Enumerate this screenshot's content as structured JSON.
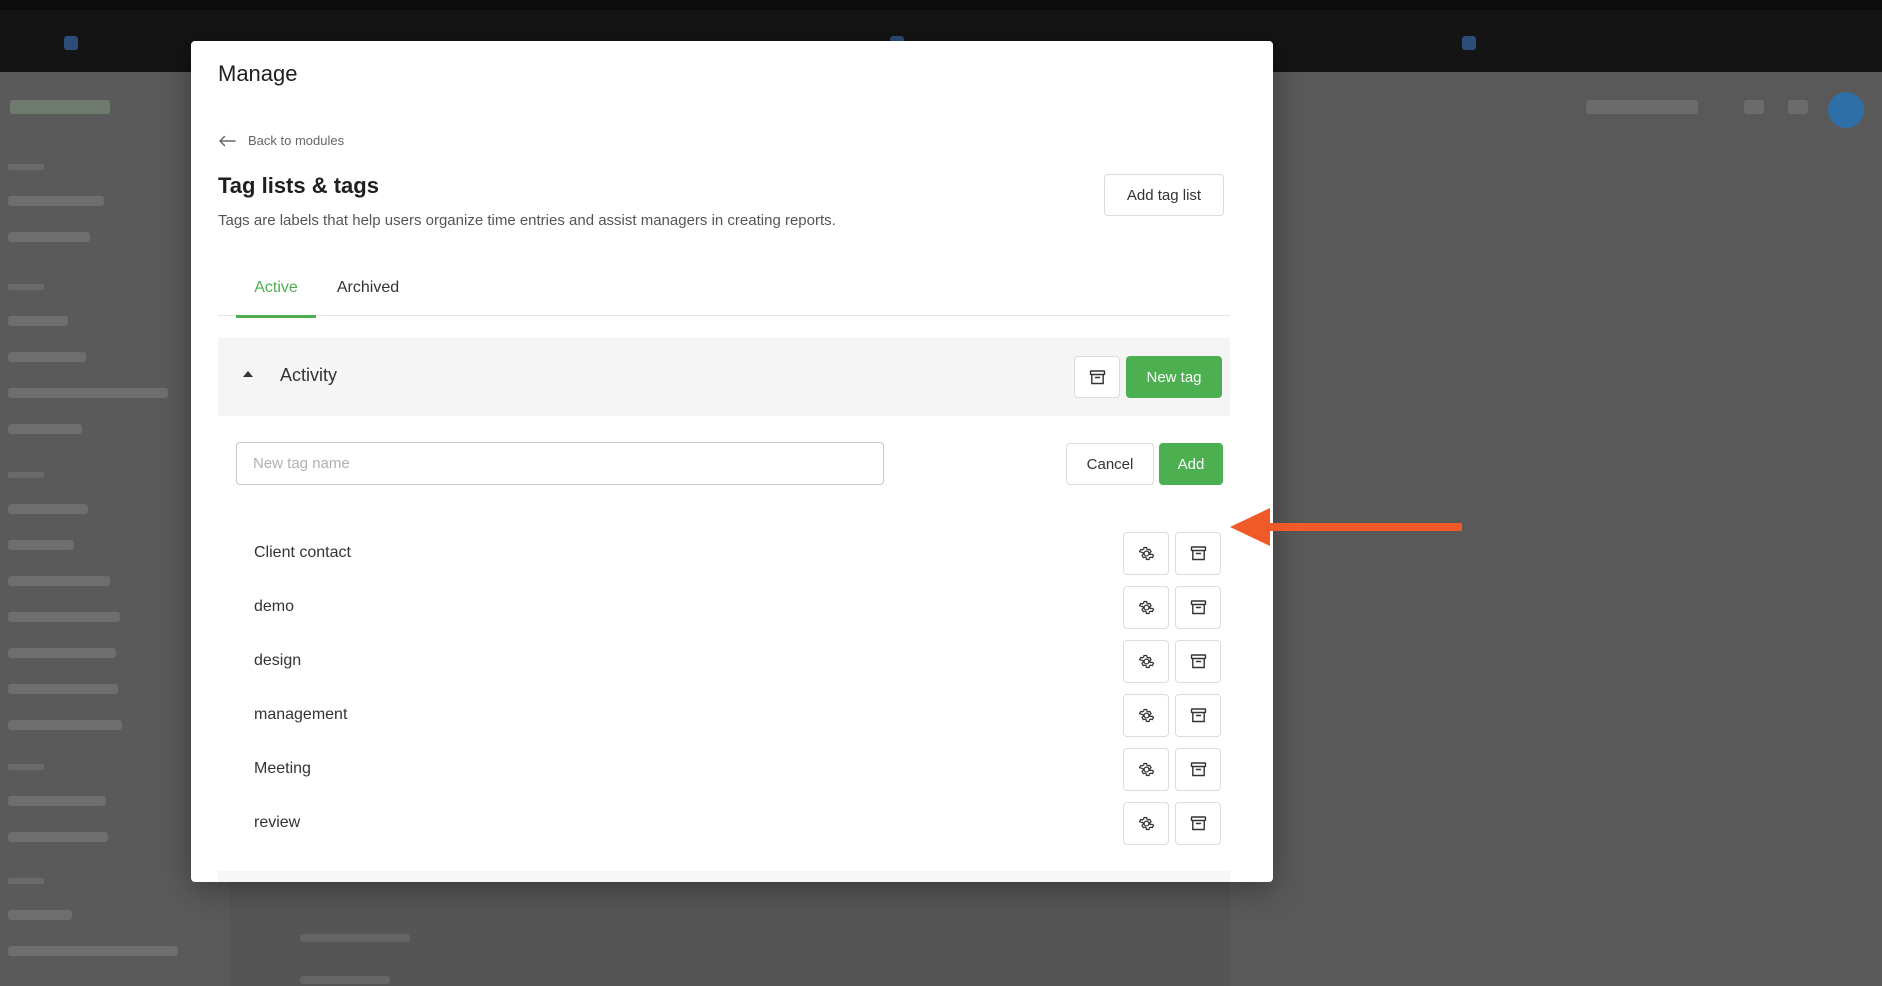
{
  "modal": {
    "title": "Manage",
    "back_label": "Back to modules",
    "section_title": "Tag lists & tags",
    "section_description": "Tags are labels that help users organize time entries and assist managers in creating reports.",
    "add_tag_list_label": "Add tag list"
  },
  "tabs": [
    {
      "label": "Active",
      "active": true
    },
    {
      "label": "Archived",
      "active": false
    }
  ],
  "tag_list": {
    "name": "Activity",
    "expanded": true,
    "new_tag_label": "New tag"
  },
  "new_tag_form": {
    "placeholder": "New tag name",
    "value": "",
    "cancel_label": "Cancel",
    "add_label": "Add"
  },
  "tags": [
    {
      "name": "Client contact"
    },
    {
      "name": "demo"
    },
    {
      "name": "design"
    },
    {
      "name": "management"
    },
    {
      "name": "Meeting"
    },
    {
      "name": "review"
    }
  ],
  "icons": {
    "settings": "gear-icon",
    "archive": "archive-box-icon",
    "back": "arrow-left-icon",
    "collapse": "caret-up-icon"
  },
  "colors": {
    "accent": "#4caf50",
    "annotation_arrow": "#f05a28",
    "overlay": "#595959"
  }
}
